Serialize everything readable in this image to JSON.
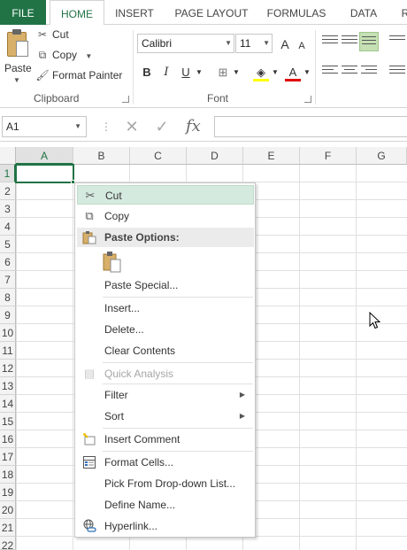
{
  "tabs": {
    "file": "FILE",
    "home": "HOME",
    "insert": "INSERT",
    "page_layout": "PAGE LAYOUT",
    "formulas": "FORMULAS",
    "data": "DATA",
    "partial": "R"
  },
  "clipboard": {
    "paste": "Paste",
    "cut": "Cut",
    "copy": "Copy",
    "format_painter": "Format Painter",
    "group_label": "Clipboard"
  },
  "font": {
    "name": "Calibri",
    "size": "11",
    "group_label": "Font",
    "bold": "B",
    "italic": "I",
    "underline": "U",
    "grow": "A",
    "shrink": "A",
    "font_color": "A"
  },
  "formula_bar": {
    "name_box": "A1",
    "fx": "fx"
  },
  "columns": [
    "A",
    "B",
    "C",
    "D",
    "E",
    "F",
    "G"
  ],
  "rows": [
    "1",
    "2",
    "3",
    "4",
    "5",
    "6",
    "7",
    "8",
    "9",
    "10",
    "11",
    "12",
    "13",
    "14",
    "15",
    "16",
    "17",
    "18",
    "19",
    "20",
    "21",
    "22"
  ],
  "context_menu": {
    "cut": "Cut",
    "copy": "Copy",
    "paste_options": "Paste Options:",
    "paste_special": "Paste Special...",
    "insert": "Insert...",
    "delete": "Delete...",
    "clear_contents": "Clear Contents",
    "quick_analysis": "Quick Analysis",
    "filter": "Filter",
    "sort": "Sort",
    "insert_comment": "Insert Comment",
    "format_cells": "Format Cells...",
    "pick_from_dropdown": "Pick From Drop-down List...",
    "define_name": "Define Name...",
    "hyperlink": "Hyperlink..."
  },
  "colors": {
    "accent": "#217346",
    "highlight": "#d5eadf"
  }
}
